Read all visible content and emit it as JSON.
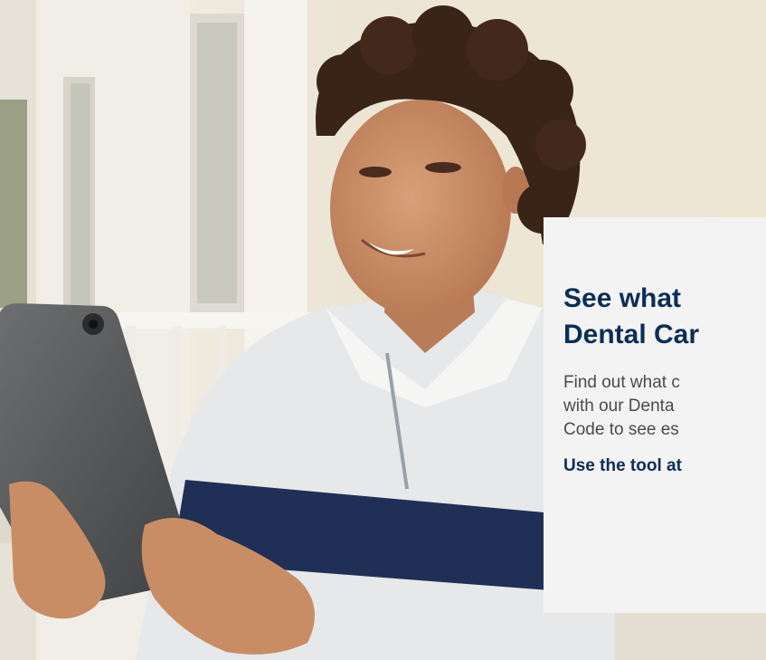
{
  "promo": {
    "title_line1": "See what",
    "title_line2": "Dental Car",
    "body_line1": "Find out what c",
    "body_line2": "with our Denta",
    "body_line3": "Code to see es",
    "link_text": "Use the tool at"
  },
  "colors": {
    "title": "#0c2e56",
    "body_text": "#4a4a4a",
    "card_background": "#f3f3f3"
  }
}
